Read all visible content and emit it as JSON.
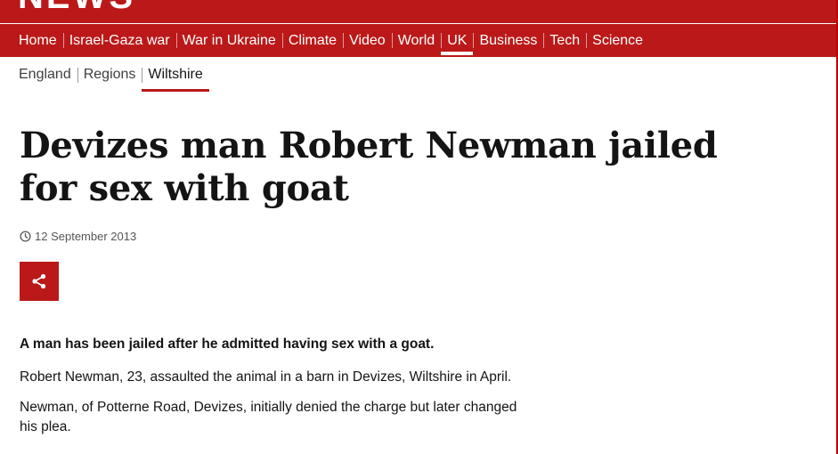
{
  "brand": {
    "logo_text": "NEWS",
    "accent": "#bb1919"
  },
  "nav": {
    "items": [
      {
        "label": "Home"
      },
      {
        "label": "Israel-Gaza war"
      },
      {
        "label": "War in Ukraine"
      },
      {
        "label": "Climate"
      },
      {
        "label": "Video"
      },
      {
        "label": "World"
      },
      {
        "label": "UK"
      },
      {
        "label": "Business"
      },
      {
        "label": "Tech"
      },
      {
        "label": "Science"
      }
    ],
    "active": "UK"
  },
  "subnav": {
    "items": [
      {
        "label": "England"
      },
      {
        "label": "Regions"
      },
      {
        "label": "Wiltshire"
      }
    ],
    "active": "Wiltshire"
  },
  "article": {
    "headline": "Devizes man Robert Newman jailed for sex with goat",
    "date": "12 September 2013",
    "share_icon": "share-icon",
    "paragraphs": [
      "A man has been jailed after he admitted having sex with a goat.",
      "Robert Newman, 23, assaulted the animal in a barn in Devizes, Wiltshire in April.",
      "Newman, of Potterne Road, Devizes, initially denied the charge but later changed his plea."
    ]
  }
}
